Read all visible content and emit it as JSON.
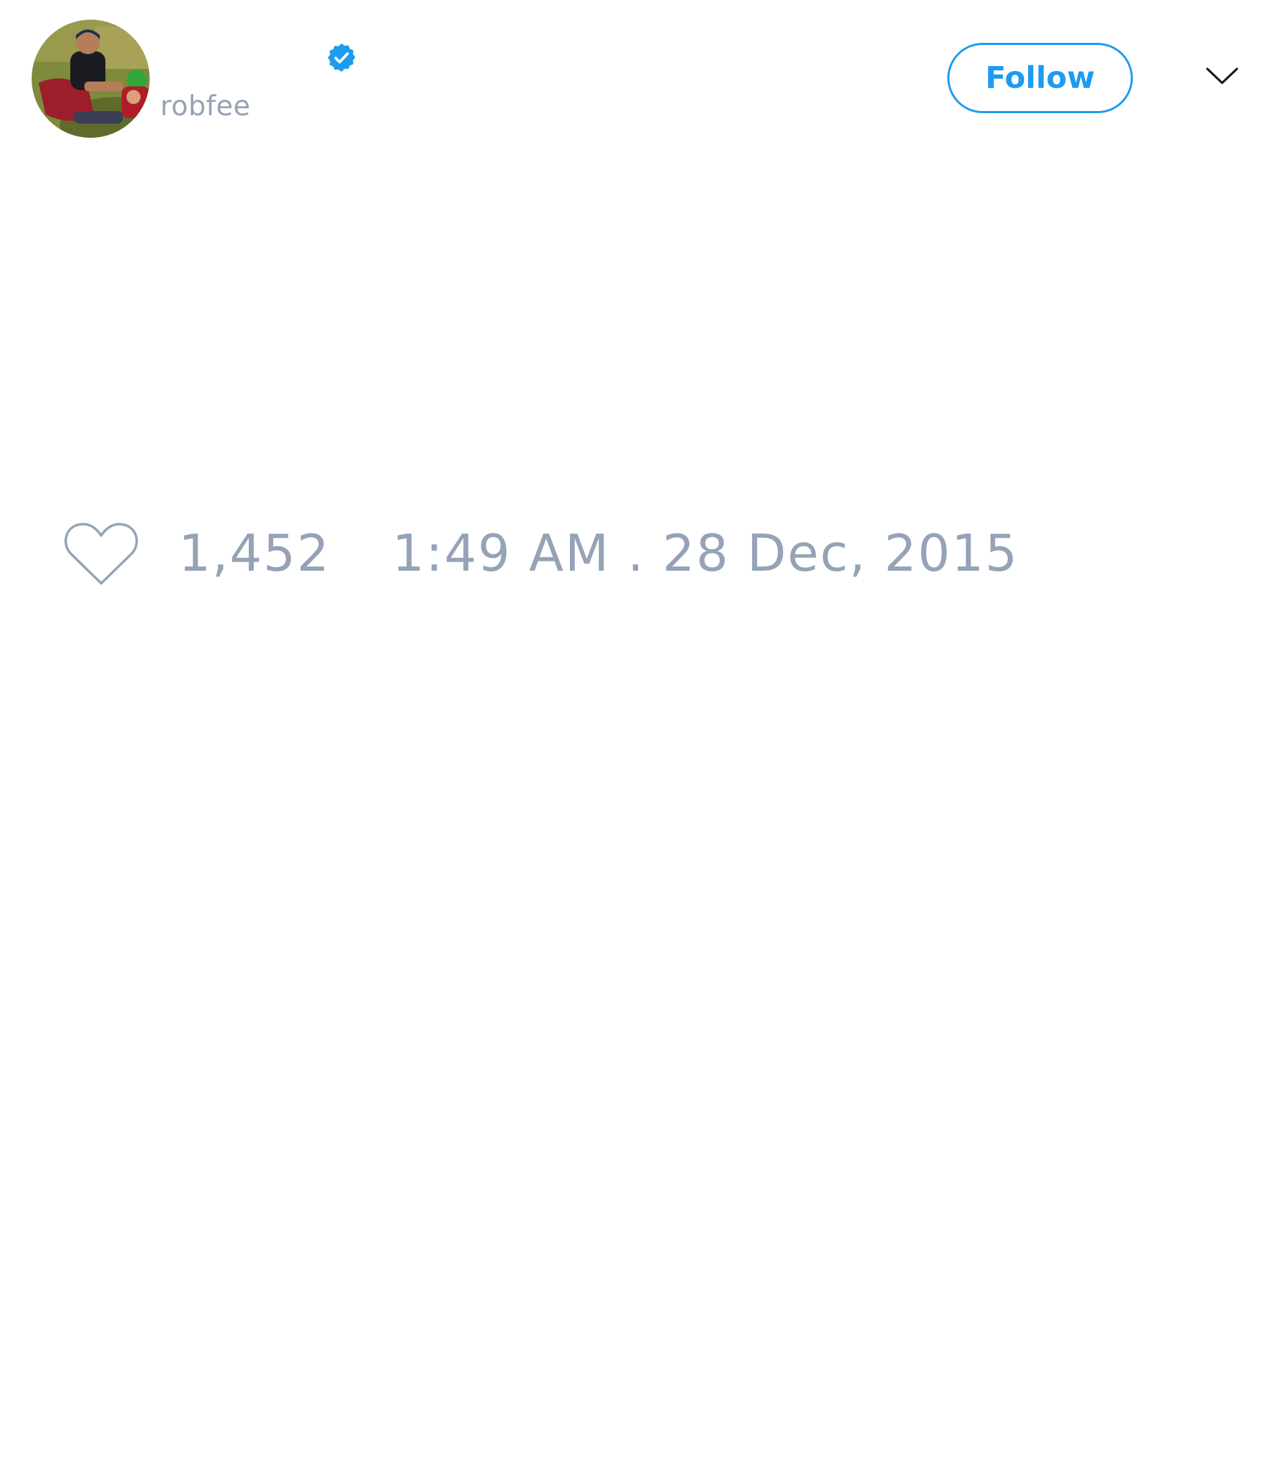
{
  "author": {
    "handle": "robfee",
    "avatar_icon": "profile-photo-avatar",
    "verified_icon": "verified-badge-icon",
    "verified_color": "#1d9bf0"
  },
  "actions": {
    "follow_label": "Follow",
    "menu_icon": "chevron-down-icon"
  },
  "stats": {
    "like_icon": "heart-icon",
    "likes": "1,452",
    "timestamp": "1:49 AM . 28 Dec, 2015"
  },
  "colors": {
    "accent": "#1d9bf0",
    "muted_text": "#95a3b6",
    "background": "#ffffff"
  }
}
